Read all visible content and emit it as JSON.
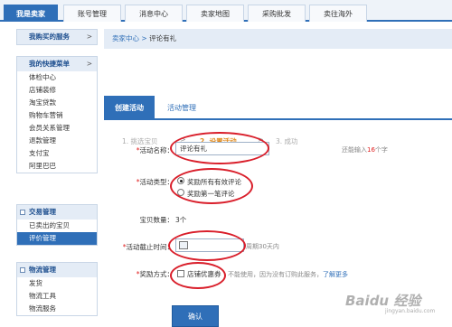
{
  "top_tabs": [
    {
      "label": "我是卖家",
      "active": true
    },
    {
      "label": "账号管理",
      "active": false
    },
    {
      "label": "消息中心",
      "active": false
    },
    {
      "label": "卖家地图",
      "active": false
    },
    {
      "label": "采购批发",
      "active": false
    },
    {
      "label": "卖往海外",
      "active": false
    }
  ],
  "sidebar": {
    "panel1": {
      "title": "我购买的服务",
      "arrow": ">"
    },
    "panel2": {
      "title": "我的快捷菜单",
      "arrow": ">",
      "items": [
        "体检中心",
        "店铺装修",
        "淘宝贷款",
        "购物车营销",
        "会员关系管理",
        "退款管理",
        "支付宝",
        "阿里巴巴"
      ]
    },
    "panel3": {
      "title": "交易管理",
      "items": [
        {
          "label": "已卖出的宝贝",
          "active": false
        },
        {
          "label": "评价管理",
          "active": true
        }
      ]
    },
    "panel4": {
      "title": "物流管理",
      "items": [
        "发货",
        "物流工具",
        "物流服务"
      ]
    }
  },
  "breadcrumb": {
    "root": "卖家中心",
    "sep": ">",
    "current": "评论有礼"
  },
  "subtabs": [
    {
      "label": "创建活动",
      "active": true
    },
    {
      "label": "活动管理",
      "active": false
    }
  ],
  "steps": {
    "s1": "1. 挑选宝贝",
    "s2": "2. 设置活动",
    "s3": "3. 成功",
    "sep": ">"
  },
  "form": {
    "name_label": "活动名称：",
    "name_value": "评论有礼",
    "name_hint_pre": "还能输入",
    "name_hint_num": "16",
    "name_hint_post": "个字",
    "type_label": "活动类型：",
    "type_option1": "奖励所有有效评论",
    "type_option2": "奖励第一笔评论",
    "count_label": "宝贝数量：",
    "count_value": "3个",
    "end_label": "活动截止时间：",
    "end_hint": "周期30天内",
    "reward_label": "奖励方式：",
    "reward_option": "店铺优惠券",
    "reward_note": "不能使用，因为没有订购此服务，",
    "reward_link": "了解更多",
    "required_mark": "*"
  },
  "confirm_label": "确认",
  "watermark": {
    "text": "Baidu 经验",
    "sub": "jingyan.baidu.com"
  },
  "colors": {
    "accent": "#2f6fb8",
    "annotation": "#d91e2a",
    "current_step": "#e08a1e"
  }
}
